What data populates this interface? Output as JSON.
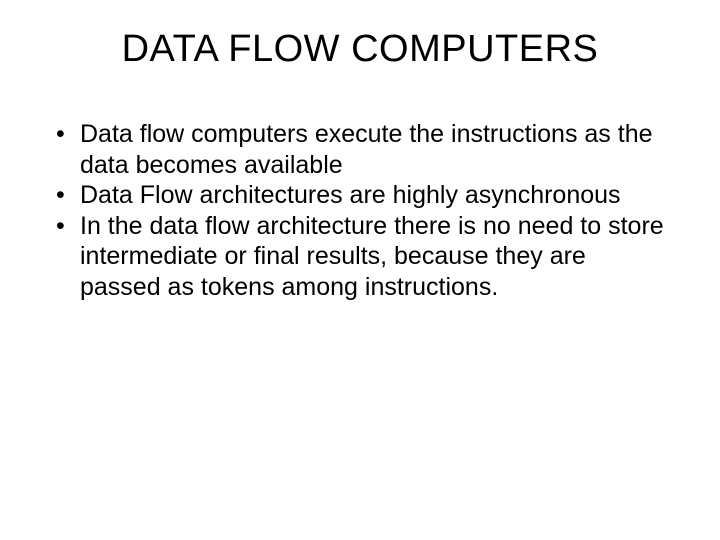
{
  "slide": {
    "title": "DATA FLOW COMPUTERS",
    "bullets": [
      "Data flow computers execute the instructions as the data becomes available",
      "Data Flow architectures are highly asynchronous",
      "In the data flow architecture there is no need to store intermediate or final results, because they are passed as tokens among instructions."
    ]
  }
}
